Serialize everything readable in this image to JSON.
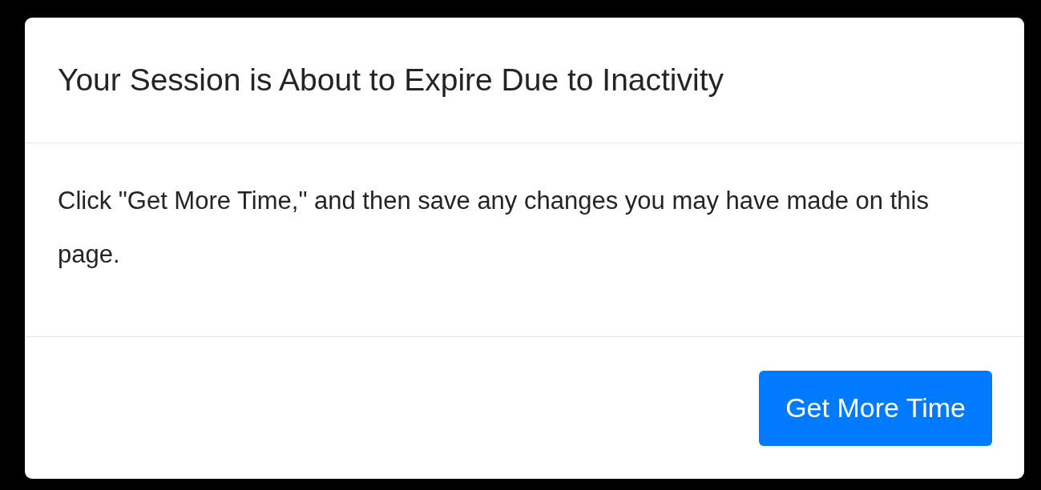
{
  "dialog": {
    "title": "Your Session is About to Expire Due to Inactivity",
    "message": "Click \"Get More Time,\" and then save any changes you may have made on this page.",
    "buttons": [
      {
        "label": "Get More Time",
        "kind": "primary"
      }
    ]
  }
}
